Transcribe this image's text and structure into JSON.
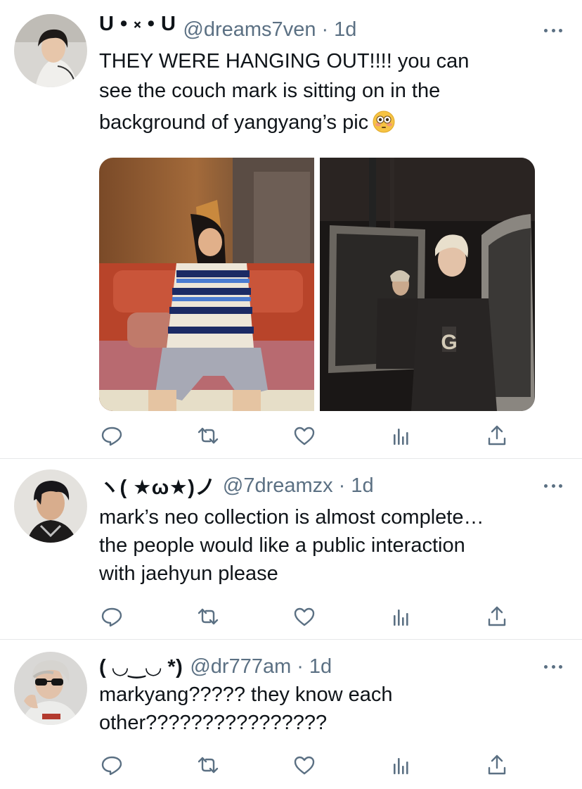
{
  "tweets": [
    {
      "name": "U • ༝ • U",
      "handle": "@dreams7ven",
      "separator": "·",
      "time": "1d",
      "lines": [
        "THEY WERE HANGING OUT!!!! you can",
        "see the couch mark is sitting on in the",
        "background of yangyang’s pic"
      ],
      "emoji": "flushed-face-emoji",
      "media": [
        "photo-on-couch",
        "photo-by-mirror"
      ]
    },
    {
      "name": "ヽ( ★ω★)ノ",
      "handle": "@7dreamzx",
      "separator": "·",
      "time": "1d",
      "lines": [
        "mark’s neo collection is almost complete…",
        "the people would like a public interaction",
        "with jaehyun please"
      ]
    },
    {
      "name": "( ◡‿◡ *)",
      "handle": "@dr777am",
      "separator": "·",
      "time": "1d",
      "lines": [
        "markyang????? they know each",
        "other????????????????"
      ]
    }
  ],
  "action_icons": [
    "reply-icon",
    "retweet-icon",
    "like-icon",
    "analytics-icon",
    "share-icon"
  ],
  "colors": {
    "icon_gray": "#5b7083",
    "text": "#0f1419",
    "divider": "#e6e8ea"
  }
}
